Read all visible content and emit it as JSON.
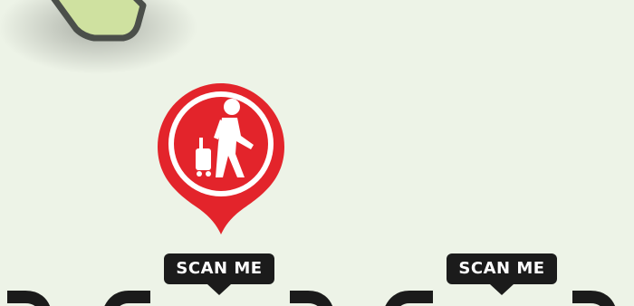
{
  "badges": {
    "first_label": "SCAN ME",
    "second_label": "SCAN ME"
  },
  "colors": {
    "background": "#edf3e7",
    "pin_red": "#e3242b",
    "badge_dark": "#1b1b1b",
    "tile_green": "#cfe1a0",
    "tile_border": "#4b4f4a"
  },
  "icons": {
    "pin": "location-pin-icon",
    "traveler": "traveler-with-luggage-icon"
  }
}
